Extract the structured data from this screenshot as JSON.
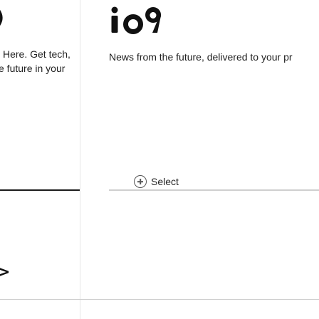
{
  "left_card": {
    "logo_fragment": ")",
    "blurb_line1": "Here. Get tech,",
    "blurb_line2": "e future in your",
    "bottom_glyph": ">"
  },
  "right_card": {
    "logo_text": "io9",
    "tagline": "News from the future, delivered to your pr",
    "select_label": "Select",
    "select_icon": "plus-circle-icon"
  },
  "colors": {
    "text": "#222222",
    "logo": "#111111",
    "divider": "#e6e6e6",
    "rule_active": "#1a1a1a",
    "rule_inactive": "#cfcfcf"
  }
}
